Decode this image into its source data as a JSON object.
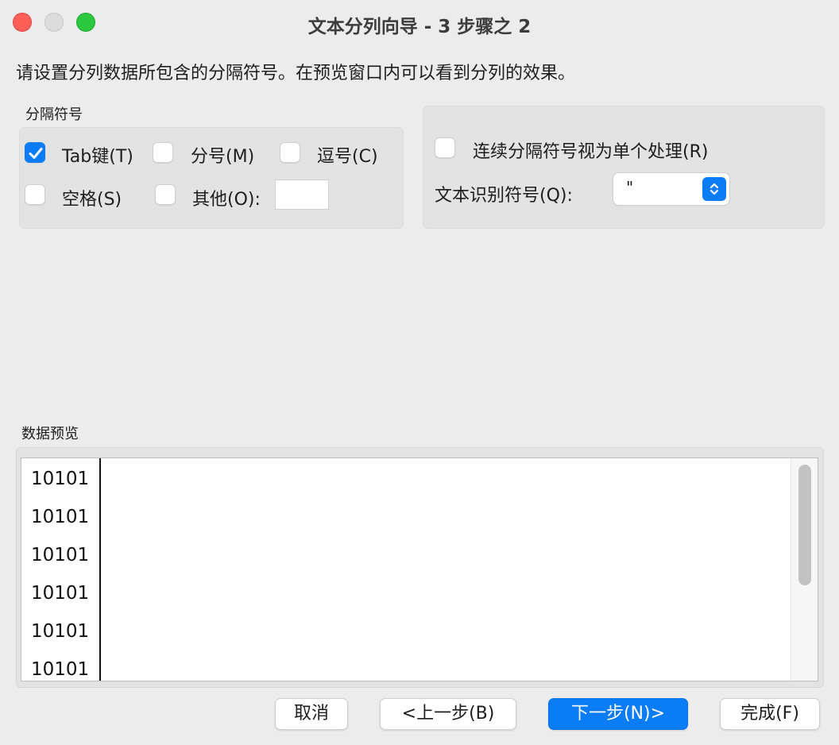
{
  "window": {
    "title": "文本分列向导 - 3 步骤之 2"
  },
  "instruction": "请设置分列数据所包含的分隔符号。在预览窗口内可以看到分列的效果。",
  "delimiters": {
    "group_label": "分隔符号",
    "tab": {
      "label": "Tab键(T)",
      "checked": true
    },
    "semicolon": {
      "label": "分号(M)",
      "checked": false
    },
    "comma": {
      "label": "逗号(C)",
      "checked": false
    },
    "space": {
      "label": "空格(S)",
      "checked": false
    },
    "other": {
      "label": "其他(O):",
      "checked": false,
      "value": ""
    }
  },
  "options": {
    "consecutive": {
      "label": "连续分隔符号视为单个处理(R)",
      "checked": false
    },
    "qualifier": {
      "label": "文本识别符号(Q):",
      "selected": "\""
    }
  },
  "preview": {
    "label": "数据预览",
    "rows": [
      "10101",
      "10101",
      "10101",
      "10101",
      "10101",
      "10101"
    ]
  },
  "buttons": {
    "cancel": "取消",
    "back": "<上一步(B)",
    "next": "下一步(N)>",
    "finish": "完成(F)"
  },
  "colors": {
    "accent": "#0a7cf5",
    "close": "#fe5f57",
    "zoom": "#2bc840"
  }
}
